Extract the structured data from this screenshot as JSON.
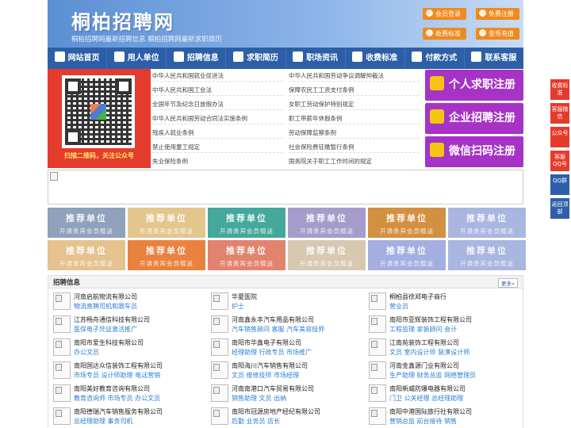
{
  "header": {
    "logo": "桐柏招聘网",
    "tagline": "桐柏招聘网最新招聘信息   桐柏招聘网最新求职简历",
    "buttons": [
      {
        "label": "会员登录"
      },
      {
        "label": "免费注册"
      },
      {
        "label": "收费标准"
      },
      {
        "label": "金币充值"
      }
    ]
  },
  "nav": [
    "网站首页",
    "用人单位",
    "招聘信息",
    "求职简历",
    "职场资讯",
    "收费标准",
    "付款方式",
    "联系客服"
  ],
  "qr": {
    "caption": "扫描二维码，关注公众号"
  },
  "laws": {
    "left": [
      "中华人民共和国就业促进法",
      "中华人民共和国工会法",
      "全国年节及纪念日放假办法",
      "中华人民共和国劳动合同法实施条例",
      "残疾人就业条例",
      "禁止使用童工规定",
      "失业保险条例"
    ],
    "right": [
      "中华人民共和国劳动争议调解仲裁法",
      "保障农民工工资支付条例",
      "女职工劳动保护特别规定",
      "职工带薪年休假条例",
      "劳动保障监察条例",
      "社会保险费征缴暂行条例",
      "国务院关于职工工作时间的规定"
    ]
  },
  "register": [
    {
      "label": "个人求职注册",
      "color": "#a632c6"
    },
    {
      "label": "企业招聘注册",
      "color": "#a632c6"
    },
    {
      "label": "微信扫码注册",
      "color": "#a632c6"
    }
  ],
  "recommend": {
    "title": "推荐单位",
    "sub": "开通贵宾会员赠送",
    "colors_row1": [
      "#8fa1bb",
      "#e3c68d",
      "#44a89c",
      "#a69ccc",
      "#d39040",
      "#a9b6e0"
    ],
    "colors_row2": [
      "#e6c28e",
      "#e9823f",
      "#e2836f",
      "#d6c9b0",
      "#a5aee0",
      "#a8b6e0"
    ]
  },
  "jobs": {
    "title": "招聘信息",
    "more": "更多»",
    "items": [
      {
        "company": "河南启航物流有限公司",
        "positions": "物流直聘司机和跟车员"
      },
      {
        "company": "华夏医院",
        "positions": "护士"
      },
      {
        "company": "桐柏县徐郑电子商行",
        "positions": "营业员"
      },
      {
        "company": "江苏畅舟通信科技有限公司",
        "positions": "医保电子凭证激活推广"
      },
      {
        "company": "河南鑫永丰汽车用品有限公司",
        "positions": "汽车销售顾问 客服 汽车美容技师"
      },
      {
        "company": "南阳市亚辉装饰工程有限公司",
        "positions": "工程监理 家装顾问 会计"
      },
      {
        "company": "南阳市爱生科技有限公司",
        "positions": "办公文员"
      },
      {
        "company": "南阳市华鑫电子有限公司",
        "positions": "经理助理 行政专员 市场推广"
      },
      {
        "company": "江南苑装饰工程有限公司",
        "positions": "文员 室内设计师 装潢设计师"
      },
      {
        "company": "南阳国达众信装饰工程有限公司",
        "positions": "市场专员 设计师助理 电话营销"
      },
      {
        "company": "南阳海川汽车销售有限公司",
        "positions": "文员 维修技师 市场经理"
      },
      {
        "company": "河南金鑫源门业有限公司",
        "positions": "生产助理 财务总监 网络管理员"
      },
      {
        "company": "南阳美好教育咨询有限公司",
        "positions": "教育咨询师 市场专员 办公文员"
      },
      {
        "company": "河南南港口汽车贸易有限公司",
        "positions": "销售助理 文员 出纳"
      },
      {
        "company": "南阳新威防爆电器有限公司",
        "positions": "门卫 公关经理 总经理助理"
      },
      {
        "company": "南阳德瑞汽车销售服务有限公司",
        "positions": "总经理助理 事务司机"
      },
      {
        "company": "南阳市冠源房地产经纪有限公司",
        "positions": "后勤 业务员 店长"
      },
      {
        "company": "南阳中港国际旅行社有限公司",
        "positions": "营销总监 前台接待 销售"
      }
    ]
  },
  "float_bar": [
    {
      "label": "收费标准",
      "color": "#e53b2c"
    },
    {
      "label": "客服微信",
      "color": "#e53b2c"
    },
    {
      "label": "公众号",
      "color": "#e53b2c"
    },
    {
      "label": "客服QQ号",
      "color": "#e53b2c"
    },
    {
      "label": "QQ群",
      "color": "#2d5fa8"
    },
    {
      "label": "返回顶部",
      "color": "#2d5fa8"
    }
  ]
}
